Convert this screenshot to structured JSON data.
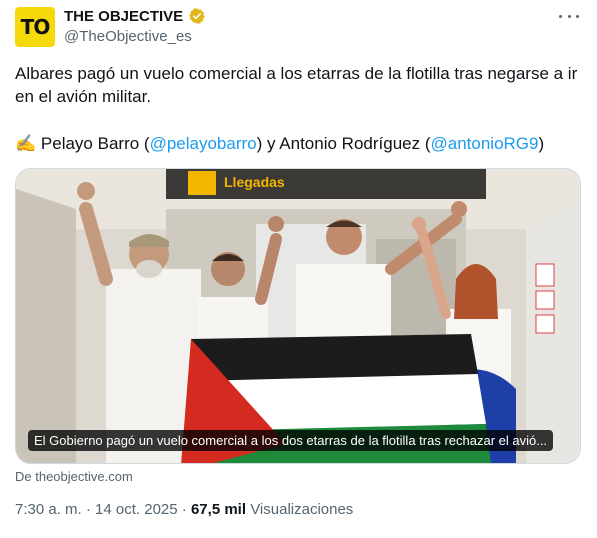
{
  "account": {
    "avatar_text": "TO",
    "display_name": "THE OBJECTIVE",
    "handle": "@TheObjective_es",
    "verified_color": "#e2b719"
  },
  "tweet": {
    "text": "Albares pagó un vuelo comercial a los etarras de la flotilla tras negarse a ir en el avión militar.",
    "credit_emoji": "✍️",
    "credit_name_1": "Pelayo Barro (",
    "mention_1": "@pelayobarro",
    "credit_middle": ") y Antonio Rodríguez (",
    "mention_2": "@antonioRG9",
    "credit_end": ")"
  },
  "media": {
    "sign_text": "Llegadas",
    "caption": "El Gobierno pagó un vuelo comercial a los dos etarras de la flotilla tras rechazar el avió..."
  },
  "source": "De theobjective.com",
  "meta": {
    "time": "7:30 a. m.",
    "separator": "·",
    "date": "14 oct. 2025",
    "views_count": "67,5 mil",
    "views_label": "Visualizaciones"
  },
  "colors": {
    "mention": "#1d9bf0",
    "avatar_bg": "#f5d90a",
    "muted": "#536471"
  }
}
